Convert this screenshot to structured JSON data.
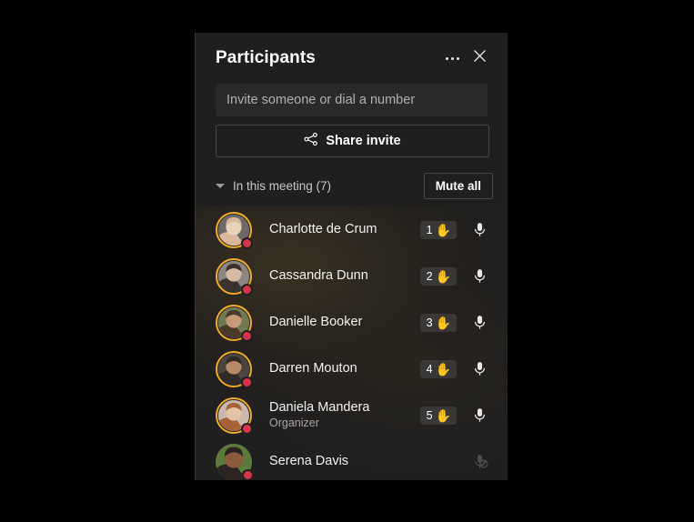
{
  "panel": {
    "title": "Participants",
    "more_label": "More options",
    "close_label": "Close",
    "more_icon": "ellipsis-icon",
    "close_icon": "close-icon"
  },
  "invite": {
    "placeholder": "Invite someone or dial a number",
    "value": "",
    "share_label": "Share invite",
    "share_icon": "share-icon"
  },
  "section": {
    "label": "In this meeting (7)",
    "count": 7,
    "mute_all_label": "Mute all",
    "chevron_icon": "chevron-down-icon"
  },
  "colors": {
    "panel_bg": "#201f1f",
    "input_bg": "#2b2a2a",
    "hand_ring": "#f0ac2a",
    "presence_busy": "#d6344a",
    "badge_bg": "#3a3837",
    "text_primary": "#f3f2f1",
    "text_secondary": "#a8a5a3",
    "border": "#4a4846"
  },
  "participants": [
    {
      "name": "Charlotte de Crum",
      "role": "",
      "hand_raised": true,
      "hand_order": "1",
      "hand_emoji": "✋",
      "presence": "busy",
      "mic_icon": "microphone-icon",
      "mic_muted": false,
      "avatar_colors": [
        "#6d6a68",
        "#d9b79a",
        "#e7d3b8"
      ]
    },
    {
      "name": "Cassandra Dunn",
      "role": "",
      "hand_raised": true,
      "hand_order": "2",
      "hand_emoji": "✋",
      "presence": "busy",
      "mic_icon": "microphone-icon",
      "mic_muted": false,
      "avatar_colors": [
        "#8d8784",
        "#3a332e",
        "#d8bba4"
      ]
    },
    {
      "name": "Danielle Booker",
      "role": "",
      "hand_raised": true,
      "hand_order": "3",
      "hand_emoji": "✋",
      "presence": "busy",
      "mic_icon": "microphone-icon",
      "mic_muted": false,
      "avatar_colors": [
        "#6f7a52",
        "#4a3a2c",
        "#c79a77"
      ]
    },
    {
      "name": "Darren Mouton",
      "role": "",
      "hand_raised": true,
      "hand_order": "4",
      "hand_emoji": "✋",
      "presence": "busy",
      "mic_icon": "microphone-icon",
      "mic_muted": false,
      "avatar_colors": [
        "#4b4540",
        "#2f2b28",
        "#b88a6a"
      ]
    },
    {
      "name": "Daniela Mandera",
      "role": "Organizer",
      "hand_raised": true,
      "hand_order": "5",
      "hand_emoji": "✋",
      "presence": "busy",
      "mic_icon": "microphone-icon",
      "mic_muted": false,
      "avatar_colors": [
        "#cbb9ad",
        "#a8633a",
        "#e5c3a6"
      ]
    },
    {
      "name": "Serena Davis",
      "role": "",
      "hand_raised": false,
      "hand_order": "",
      "hand_emoji": "",
      "presence": "busy",
      "mic_icon": "microphone-off-icon",
      "mic_muted": true,
      "avatar_colors": [
        "#5d7a3c",
        "#2b2420",
        "#8a5c3c"
      ]
    }
  ]
}
